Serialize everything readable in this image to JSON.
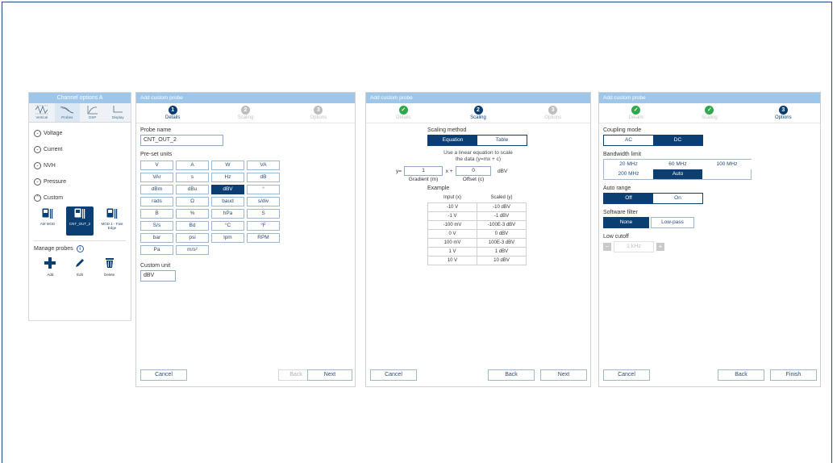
{
  "channel_options": {
    "title": "Channel options  A",
    "tabs": [
      {
        "label": "Vertical",
        "icon": "vertical-icon"
      },
      {
        "label": "Probes",
        "icon": "probes-icon"
      },
      {
        "label": "DSP",
        "icon": "dsp-icon"
      },
      {
        "label": "Display",
        "icon": "display-icon"
      }
    ],
    "categories": [
      {
        "label": "Voltage",
        "state": "collapsed"
      },
      {
        "label": "Current",
        "state": "collapsed"
      },
      {
        "label": "NVH",
        "state": "collapsed"
      },
      {
        "label": "Pressure",
        "state": "collapsed"
      },
      {
        "label": "Custom",
        "state": "expanded"
      }
    ],
    "probes": [
      {
        "label": "AM MOD",
        "selected": false
      },
      {
        "label": "CNT_OUT_2",
        "selected": true
      },
      {
        "label": "MOD 1 - Fast Edge",
        "selected": false
      }
    ],
    "manage_label": "Manage probes",
    "actions": [
      {
        "label": "Add",
        "icon": "plus-icon"
      },
      {
        "label": "Edit",
        "icon": "pencil-icon"
      },
      {
        "label": "Delete",
        "icon": "trash-icon"
      }
    ]
  },
  "wizard": {
    "title": "Add custom probe",
    "steps": [
      "Details",
      "Scaling",
      "Options"
    ],
    "buttons": {
      "cancel": "Cancel",
      "back": "Back",
      "next": "Next",
      "finish": "Finish"
    }
  },
  "details": {
    "probe_name_label": "Probe name",
    "probe_name_value": "CNT_OUT_2",
    "preset_label": "Pre-set units",
    "units": [
      "V",
      "A",
      "W",
      "VA",
      "VAr",
      "s",
      "Hz",
      "dB",
      "dBm",
      "dBu",
      "dBV",
      "°",
      "rads",
      "Ω",
      "baud",
      "s/div",
      "B",
      "%",
      "hPa",
      "S",
      "S/s",
      "Bd",
      "°C",
      "°F",
      "bar",
      "psi",
      "lpm",
      "RPM",
      "Pa",
      "m/s²"
    ],
    "selected_unit": "dBV",
    "custom_unit_label": "Custom unit",
    "custom_unit_value": "dBV"
  },
  "scaling": {
    "method_label": "Scaling method",
    "methods": [
      "Equation",
      "Table"
    ],
    "selected_method": "Equation",
    "instruction_line1": "Use a linear equation to scale",
    "instruction_line2": "the data (y=mx + c)",
    "y_label": "y=",
    "gradient_value": "1",
    "x_plus": "x +",
    "offset_value": "0",
    "unit": "dBV",
    "gradient_label": "Gradient (m)",
    "offset_label": "Offset (c)",
    "example_label": "Example",
    "table_headers": [
      "Input (x)",
      "Scaled (y)"
    ],
    "table_rows": [
      [
        "-10 V",
        "-10 dBV"
      ],
      [
        "-1 V",
        "-1 dBV"
      ],
      [
        "-100 mV",
        "-100E-3 dBV"
      ],
      [
        "0 V",
        "0 dBV"
      ],
      [
        "100 mV",
        "100E-3 dBV"
      ],
      [
        "1 V",
        "1 dBV"
      ],
      [
        "10 V",
        "10 dBV"
      ]
    ]
  },
  "options": {
    "coupling_label": "Coupling mode",
    "coupling": [
      "AC",
      "DC"
    ],
    "coupling_selected": "DC",
    "bandwidth_label": "Bandwidth limit",
    "bandwidth": [
      "20 MHz",
      "60 MHz",
      "100 MHz",
      "200 MHz",
      "Auto"
    ],
    "bandwidth_selected": "Auto",
    "autorange_label": "Auto range",
    "autorange": [
      "Off",
      "On"
    ],
    "autorange_selected": "Off",
    "filter_label": "Software filter",
    "filter": [
      "None",
      "Low-pass"
    ],
    "filter_selected": "None",
    "cutoff_label": "Low cutoff",
    "cutoff_value": "1 kHz",
    "minus": "−",
    "plus": "+"
  },
  "colors": {
    "accent": "#0b3f73",
    "header": "#9ec6ea",
    "done": "#2ea84a",
    "pending": "#bdbdbd"
  }
}
